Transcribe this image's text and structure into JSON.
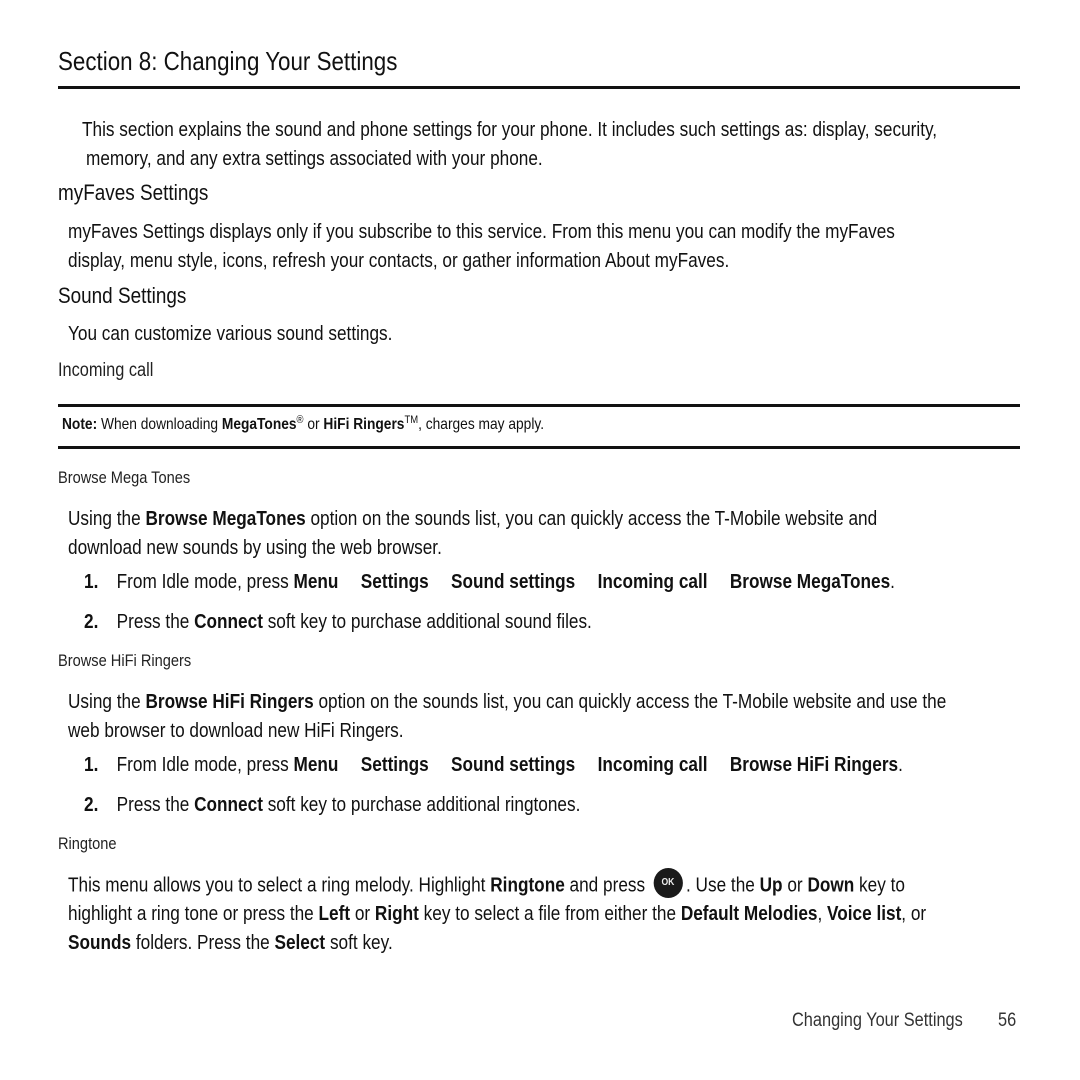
{
  "page": {
    "title": "Section 8: Changing Your Settings",
    "intro": [
      "This section explains the sound and phone settings for your phone. It includes such settings as: display, security,",
      "memory, and any extra settings associated with your phone."
    ],
    "myfaves": {
      "heading": "myFaves Settings",
      "lines": [
        "myFaves Settings displays only if you subscribe to this service. From this menu you can modify the myFaves",
        "display, menu style, icons, refresh your contacts, or gather information About myFaves."
      ]
    },
    "sound": {
      "heading": "Sound Settings",
      "text": "You can customize various sound settings.",
      "incoming_heading": "Incoming call"
    },
    "note": {
      "label": "Note:",
      "text1": "When downloading",
      "brand1": "MegaTones",
      "sup1": "®",
      "text2": "or",
      "brand2": "HiFi Ringers",
      "sup2": "TM",
      "text3": ", charges may apply."
    },
    "mega": {
      "heading": "Browse Mega Tones",
      "line1_pre": "Using the",
      "line1_bold": "Browse MegaTones",
      "line1_post": "option on the sounds list, you can quickly access the T-Mobile website and",
      "line2": "download new sounds by using the web browser.",
      "steps": [
        {
          "num": "1.",
          "pre": "From Idle mode, press",
          "path": [
            "Menu",
            "Settings",
            "Sound settings",
            "Incoming call",
            "Browse MegaTones"
          ],
          "post": "."
        },
        {
          "num": "2.",
          "pre": "Press the",
          "bold": "Connect",
          "post": "soft key to purchase additional sound files."
        }
      ]
    },
    "hifi": {
      "heading": "Browse HiFi Ringers",
      "line1_pre": "Using the",
      "line1_bold": "Browse HiFi Ringers",
      "line1_post": "option on the sounds list, you can quickly access the T-Mobile website and use the",
      "line2": "web browser to download new HiFi Ringers.",
      "steps": [
        {
          "num": "1.",
          "pre": "From Idle mode, press",
          "path": [
            "Menu",
            "Settings",
            "Sound settings",
            "Incoming call",
            "Browse HiFi Ringers"
          ],
          "post": "."
        },
        {
          "num": "2.",
          "pre": "Press the",
          "bold": "Connect",
          "post": "soft key to purchase additional ringtones."
        }
      ]
    },
    "ringtone": {
      "heading": "Ringtone",
      "l1_a": "This menu allows you to select a ring melody. Highlight",
      "l1_b": "Ringtone",
      "l1_c": "and press",
      "ok_key_label": "OK",
      "l1_d": ". Use the",
      "l1_e": "Up",
      "l1_f": "or",
      "l1_g": "Down",
      "l1_h": "key to",
      "l2_a": "highlight a ring tone or press the",
      "l2_b": "Left",
      "l2_c": "or",
      "l2_d": "Right",
      "l2_e": "key to select a file from either the",
      "l2_f": "Default Melodies",
      "l2_g": ",",
      "l2_h": "Voice list",
      "l2_i": ", or",
      "l3_a": "Sounds",
      "l3_b": "folders. Press the",
      "l3_c": "Select",
      "l3_d": "soft key."
    },
    "footer": {
      "section": "Changing Your Settings",
      "page_number": "56"
    }
  }
}
